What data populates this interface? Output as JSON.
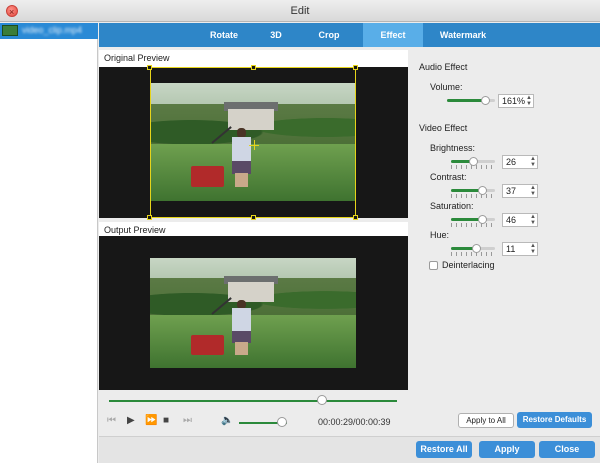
{
  "window": {
    "title": "Edit"
  },
  "sidebar": {
    "file_name": "video_clip.mp4"
  },
  "tabs": [
    {
      "label": "Rotate"
    },
    {
      "label": "3D"
    },
    {
      "label": "Crop"
    },
    {
      "label": "Effect",
      "active": true
    },
    {
      "label": "Watermark"
    }
  ],
  "preview": {
    "original_label": "Original Preview",
    "output_label": "Output Preview"
  },
  "player": {
    "timecode": "00:00:29/00:00:39",
    "progress": 0.74,
    "volume_level": 0.9
  },
  "audio_effect": {
    "title": "Audio Effect",
    "volume_label": "Volume:",
    "volume_value": "161%",
    "volume_level": 0.8
  },
  "video_effect": {
    "title": "Video Effect",
    "brightness_label": "Brightness:",
    "brightness_value": "26",
    "brightness_level": 0.5,
    "contrast_label": "Contrast:",
    "contrast_value": "37",
    "contrast_level": 0.7,
    "saturation_label": "Saturation:",
    "saturation_value": "46",
    "saturation_level": 0.7,
    "hue_label": "Hue:",
    "hue_value": "11",
    "hue_level": 0.57,
    "deinterlacing_label": "Deinterlacing"
  },
  "buttons": {
    "apply_to_all": "Apply to All",
    "restore_defaults": "Restore Defaults",
    "restore_all": "Restore All",
    "apply": "Apply",
    "close": "Close"
  },
  "icons": {
    "close_window": "close-icon",
    "skip_back": "skip-back-icon",
    "play": "play-icon",
    "fast_forward": "fast-forward-icon",
    "stop": "stop-icon",
    "skip_forward": "skip-forward-icon",
    "volume": "speaker-icon"
  },
  "colors": {
    "tab_bar": "#2e86c8",
    "tab_active": "#59aee8",
    "slider_fill": "#2b8a3b",
    "button_blue": "#3c8fd8",
    "crop_frame": "#e6d41a"
  }
}
